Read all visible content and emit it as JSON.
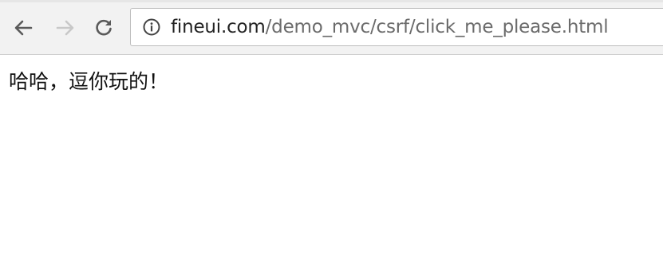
{
  "browser": {
    "address_bar": {
      "host": "fineui.com",
      "path": "/demo_mvc/csrf/click_me_please.html"
    },
    "icons": {
      "back": "back-arrow-icon",
      "forward": "forward-arrow-icon",
      "reload": "reload-icon",
      "site_info": "info-icon"
    },
    "colors": {
      "toolbar_bg": "#f2f2f2",
      "icon_active": "#5a5a5a",
      "icon_disabled": "#c8c8c8",
      "url_host": "#222222",
      "url_path": "#6b6b6b"
    }
  },
  "page": {
    "message": "哈哈，逗你玩的！"
  }
}
